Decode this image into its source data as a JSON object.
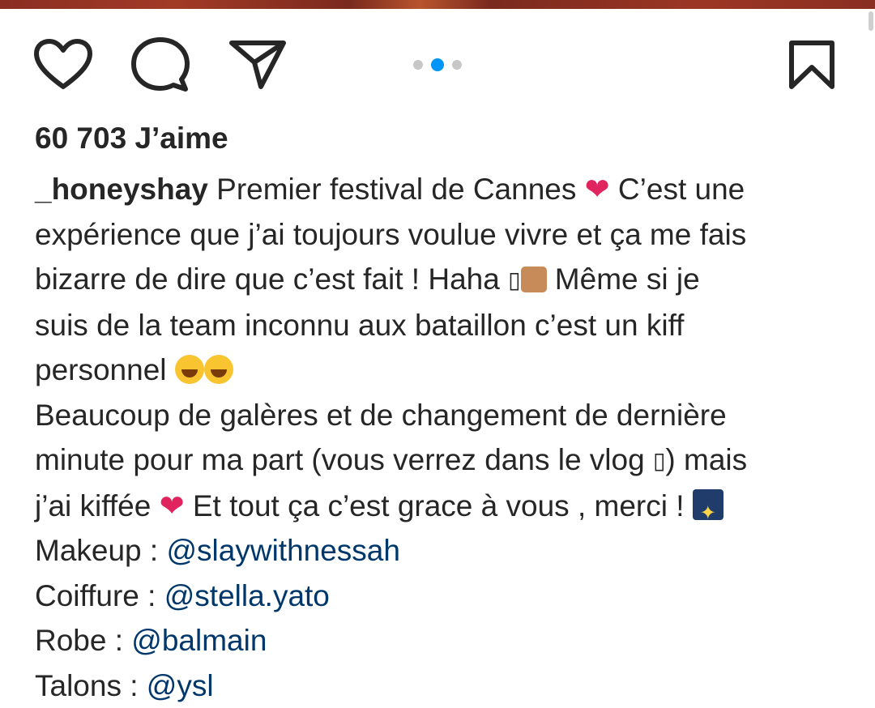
{
  "post": {
    "likes_label": "60 703 J’aime",
    "username": "_honeyshay",
    "carousel": {
      "total": 3,
      "active_index": 1
    },
    "caption": {
      "line1_text": " Premier festival de Cannes ",
      "line1_after_heart": " C’est une",
      "line2": "expérience que j’ai toujours voulue vivre et ça me fais",
      "line3_before": "bizarre de dire que c’est fait ! Haha ",
      "line3_after": " Même si je",
      "line4": "suis de la team inconnu aux bataillon c’est un kiff",
      "line5": "personnel ",
      "line6": "Beaucoup de galères et de changement de dernière",
      "line7_before": "minute pour ma part (vous verrez dans le vlog ",
      "line7_after": ") mais",
      "line8_before": "j’ai kiffée ",
      "line8_after": " Et tout ça c’est grace à vous , merci ! ",
      "heart_emoji": "❤",
      "tofu_glyph": "▯"
    },
    "credits": [
      {
        "label": "Makeup : ",
        "mention": "@slaywithnessah"
      },
      {
        "label": "Coiffure : ",
        "mention": "@stella.yato"
      },
      {
        "label": "Robe : ",
        "mention": "@balmain"
      },
      {
        "label": "Talons : ",
        "mention": "@ysl"
      }
    ]
  },
  "icons": {
    "like": "heart-icon",
    "comment": "comment-bubble-icon",
    "share": "paper-plane-icon",
    "save": "bookmark-icon"
  },
  "colors": {
    "mention": "#00376b",
    "active_dot": "#0095f6",
    "inactive_dot": "#c7c7c7",
    "text": "#262626",
    "heart": "#e0245e"
  }
}
